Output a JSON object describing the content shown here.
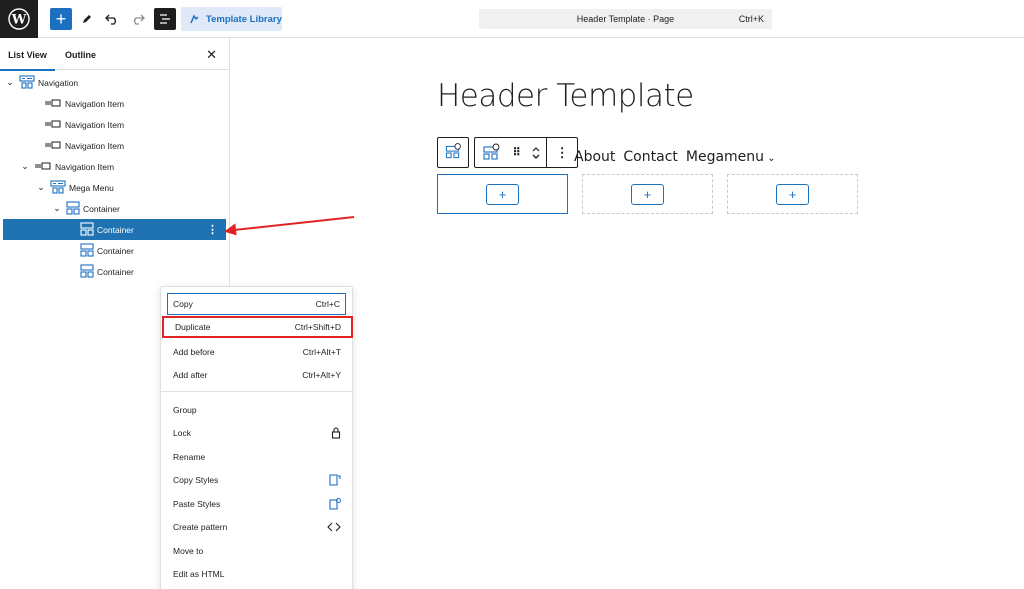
{
  "topbar": {
    "template_library_label": "Template Library",
    "command_title": "Header Template · Page",
    "command_shortcut": "Ctrl+K"
  },
  "sidebar": {
    "tabs": [
      "List View",
      "Outline"
    ],
    "tree": [
      {
        "label": "Navigation",
        "chevron": "›",
        "icon": "navigation-block-icon"
      },
      {
        "label": "Navigation Item",
        "chevron": "",
        "icon": "navigation-item-icon"
      },
      {
        "label": "Navigation Item",
        "chevron": "",
        "icon": "navigation-item-icon"
      },
      {
        "label": "Navigation Item",
        "chevron": "",
        "icon": "navigation-item-icon"
      },
      {
        "label": "Navigation Item",
        "chevron": "›",
        "icon": "navigation-item-icon"
      },
      {
        "label": "Mega Menu",
        "chevron": "›",
        "icon": "mega-menu-icon"
      },
      {
        "label": "Container",
        "chevron": "›",
        "icon": "container-icon"
      },
      {
        "label": "Container",
        "chevron": "",
        "icon": "container-icon",
        "selected": true
      },
      {
        "label": "Container",
        "chevron": "",
        "icon": "container-icon"
      },
      {
        "label": "Container",
        "chevron": "",
        "icon": "container-icon"
      }
    ]
  },
  "canvas": {
    "page_title": "Header Template",
    "nav_links": [
      "About",
      "Contact",
      "Megamenu"
    ],
    "plus_label": "+"
  },
  "context_menu": {
    "items": [
      {
        "label": "Copy",
        "shortcut": "Ctrl+C"
      },
      {
        "label": "Duplicate",
        "shortcut": "Ctrl+Shift+D"
      },
      {
        "label": "Add before",
        "shortcut": "Ctrl+Alt+T"
      },
      {
        "label": "Add after",
        "shortcut": "Ctrl+Alt+Y"
      },
      {
        "label": "Group",
        "shortcut": ""
      },
      {
        "label": "Lock",
        "shortcut": "",
        "icon": "lock-icon"
      },
      {
        "label": "Rename",
        "shortcut": ""
      },
      {
        "label": "Copy Styles",
        "shortcut": "",
        "icon": "copy-styles-icon"
      },
      {
        "label": "Paste Styles",
        "shortcut": "",
        "icon": "paste-styles-icon"
      },
      {
        "label": "Create pattern",
        "shortcut": "",
        "icon": "pattern-icon"
      },
      {
        "label": "Move to",
        "shortcut": ""
      },
      {
        "label": "Edit as HTML",
        "shortcut": ""
      }
    ]
  },
  "colors": {
    "accent": "#1d6fc2",
    "selected_row": "#1f73b2",
    "annotation_red": "#e02424"
  }
}
